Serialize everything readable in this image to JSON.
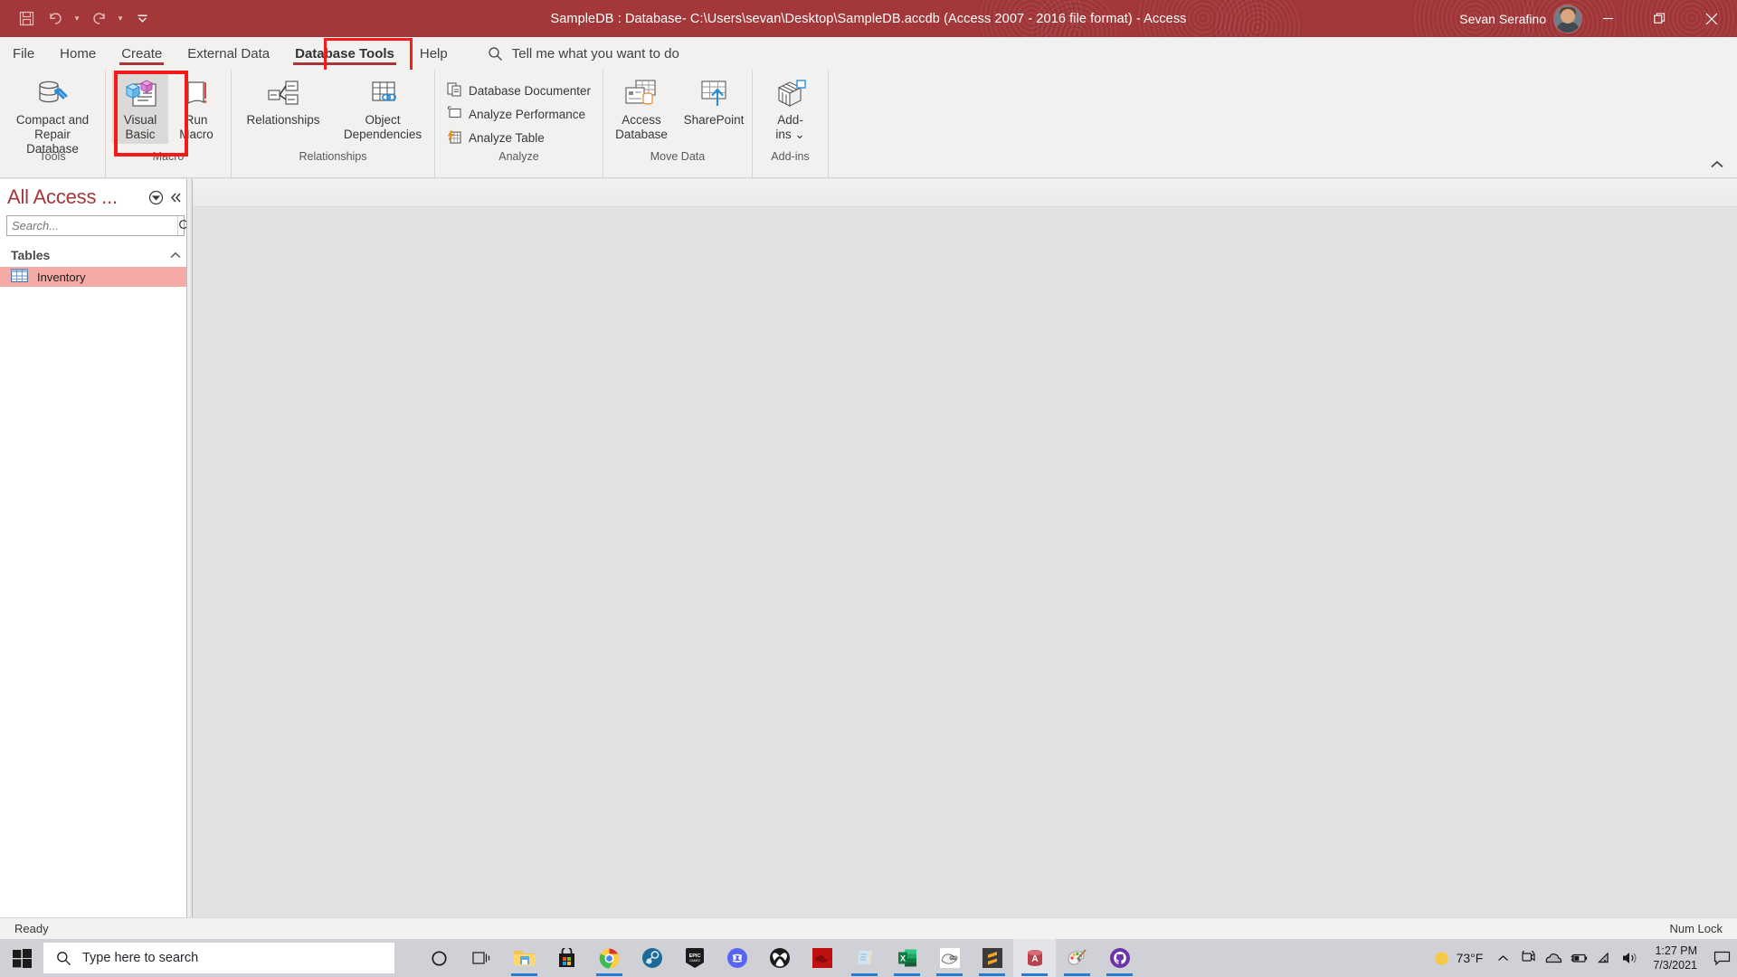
{
  "titlebar": {
    "quick_access": [
      {
        "name": "save-icon",
        "label": "Save"
      },
      {
        "name": "undo-icon",
        "label": "Undo"
      },
      {
        "name": "redo-icon",
        "label": "Redo"
      },
      {
        "name": "customize-qat-icon",
        "label": "Customize Quick Access Toolbar"
      }
    ],
    "title": "SampleDB : Database- C:\\Users\\sevan\\Desktop\\SampleDB.accdb (Access 2007 - 2016 file format)  -  Access",
    "account_name": "Sevan Serafino",
    "window_controls": [
      {
        "name": "minimize-button",
        "glyph": "—"
      },
      {
        "name": "restore-button",
        "glyph": "❐"
      },
      {
        "name": "close-button",
        "glyph": "✕"
      }
    ],
    "accent_color": "#a4373a"
  },
  "tabs": [
    {
      "label": "File",
      "active": false,
      "underline": false
    },
    {
      "label": "Home",
      "active": false,
      "underline": false
    },
    {
      "label": "Create",
      "active": false,
      "underline": true
    },
    {
      "label": "External Data",
      "active": false,
      "underline": false
    },
    {
      "label": "Database Tools",
      "active": true,
      "underline": true
    },
    {
      "label": "Help",
      "active": false,
      "underline": false
    }
  ],
  "tellme": {
    "icon": "search-icon",
    "placeholder": "Tell me what you want to do"
  },
  "highlights": {
    "color": "#f61b1b",
    "tab_target": "Database Tools",
    "button_target": "Visual Basic"
  },
  "ribbon": {
    "collapse_icon": "chevron-up-icon",
    "groups": [
      {
        "label": "Tools",
        "buttons": [
          {
            "name": "compact-and-repair-database-button",
            "label": "Compact and\nRepair Database",
            "line1": "Compact and",
            "line2": "Repair Database",
            "icon": "database-repair-icon",
            "selected": false
          }
        ]
      },
      {
        "label": "Macro",
        "buttons": [
          {
            "name": "visual-basic-button",
            "line1": "Visual",
            "line2": "Basic",
            "icon": "visual-basic-icon",
            "selected": true
          },
          {
            "name": "run-macro-button",
            "line1": "Run",
            "line2": "Macro",
            "icon": "run-macro-icon",
            "selected": false
          }
        ]
      },
      {
        "label": "Relationships",
        "buttons": [
          {
            "name": "relationships-button",
            "line1": "Relationships",
            "line2": "",
            "icon": "relationships-icon",
            "selected": false
          },
          {
            "name": "object-dependencies-button",
            "line1": "Object",
            "line2": "Dependencies",
            "icon": "object-dependencies-icon",
            "selected": false
          }
        ]
      },
      {
        "label": "Analyze",
        "small_buttons": [
          {
            "name": "database-documenter-button",
            "label": "Database Documenter",
            "icon": "documenter-icon"
          },
          {
            "name": "analyze-performance-button",
            "label": "Analyze Performance",
            "icon": "performance-icon"
          },
          {
            "name": "analyze-table-button",
            "label": "Analyze Table",
            "icon": "analyze-table-icon"
          }
        ]
      },
      {
        "label": "Move Data",
        "buttons": [
          {
            "name": "access-database-button",
            "line1": "Access",
            "line2": "Database",
            "icon": "access-database-icon",
            "selected": false
          },
          {
            "name": "sharepoint-button",
            "line1": "SharePoint",
            "line2": "",
            "icon": "sharepoint-icon",
            "selected": false
          }
        ]
      },
      {
        "label": "Add-ins",
        "buttons": [
          {
            "name": "add-ins-button",
            "line1": "Add-",
            "line2": "ins ⌄",
            "icon": "add-ins-icon",
            "selected": false
          }
        ]
      }
    ]
  },
  "navpane": {
    "title": "All Access ...",
    "title_color": "#a4373a",
    "menu_icon": "dropdown-circle-icon",
    "collapse_icon": "double-chevron-left-icon",
    "search_placeholder": "Search...",
    "search_value": "",
    "search_icon": "magnifier-icon",
    "groups": [
      {
        "label": "Tables",
        "collapse_icon": "chevron-up-icon",
        "items": [
          {
            "label": "Inventory",
            "icon": "table-icon",
            "selected": true,
            "selected_color": "#f6aaa6"
          }
        ]
      }
    ]
  },
  "statusbar": {
    "left": "Ready",
    "right": "Num Lock"
  },
  "taskbar": {
    "start_icon": "windows-logo-icon",
    "search": {
      "icon": "search-icon",
      "placeholder": "Type here to search"
    },
    "icons": [
      {
        "name": "cortana-icon",
        "label": "Cortana",
        "running": false,
        "active": false
      },
      {
        "name": "task-view-icon",
        "label": "Task View",
        "running": false,
        "active": false
      },
      {
        "name": "file-explorer-icon",
        "label": "File Explorer",
        "running": true,
        "active": false
      },
      {
        "name": "microsoft-store-icon",
        "label": "Microsoft Store",
        "running": false,
        "active": false
      },
      {
        "name": "google-chrome-icon",
        "label": "Google Chrome",
        "running": true,
        "active": false
      },
      {
        "name": "steam-icon",
        "label": "Steam",
        "running": false,
        "active": false
      },
      {
        "name": "epic-games-icon",
        "label": "Epic Games",
        "running": false,
        "active": false
      },
      {
        "name": "discord-icon",
        "label": "Discord",
        "running": false,
        "active": false
      },
      {
        "name": "xbox-icon",
        "label": "Xbox",
        "running": false,
        "active": false
      },
      {
        "name": "mongodb-icon",
        "label": "MongoDB",
        "running": false,
        "active": false
      },
      {
        "name": "notepad-icon",
        "label": "Notepad",
        "running": true,
        "active": false
      },
      {
        "name": "microsoft-excel-icon",
        "label": "Microsoft Excel",
        "running": true,
        "active": false
      },
      {
        "name": "gimp-icon",
        "label": "GIMP",
        "running": true,
        "active": false
      },
      {
        "name": "sublime-text-icon",
        "label": "Sublime Text",
        "running": true,
        "active": false
      },
      {
        "name": "microsoft-access-icon",
        "label": "Microsoft Access",
        "running": true,
        "active": true
      },
      {
        "name": "paint-icon",
        "label": "Paint",
        "running": true,
        "active": false
      },
      {
        "name": "github-desktop-icon",
        "label": "GitHub Desktop",
        "running": true,
        "active": false
      }
    ],
    "weather": {
      "icon": "sun-icon",
      "temperature": "73°F"
    },
    "tray": [
      {
        "name": "show-hidden-icons-icon",
        "glyph": "chevron-up"
      },
      {
        "name": "webcam-icon",
        "glyph": "camera"
      },
      {
        "name": "onedrive-icon",
        "glyph": "cloud"
      },
      {
        "name": "battery-icon",
        "glyph": "battery"
      },
      {
        "name": "network-icon",
        "glyph": "wifi"
      },
      {
        "name": "volume-icon",
        "glyph": "speaker"
      }
    ],
    "clock": {
      "time": "1:27 PM",
      "date": "7/3/2021"
    },
    "action_center_icon": "notification-icon"
  }
}
